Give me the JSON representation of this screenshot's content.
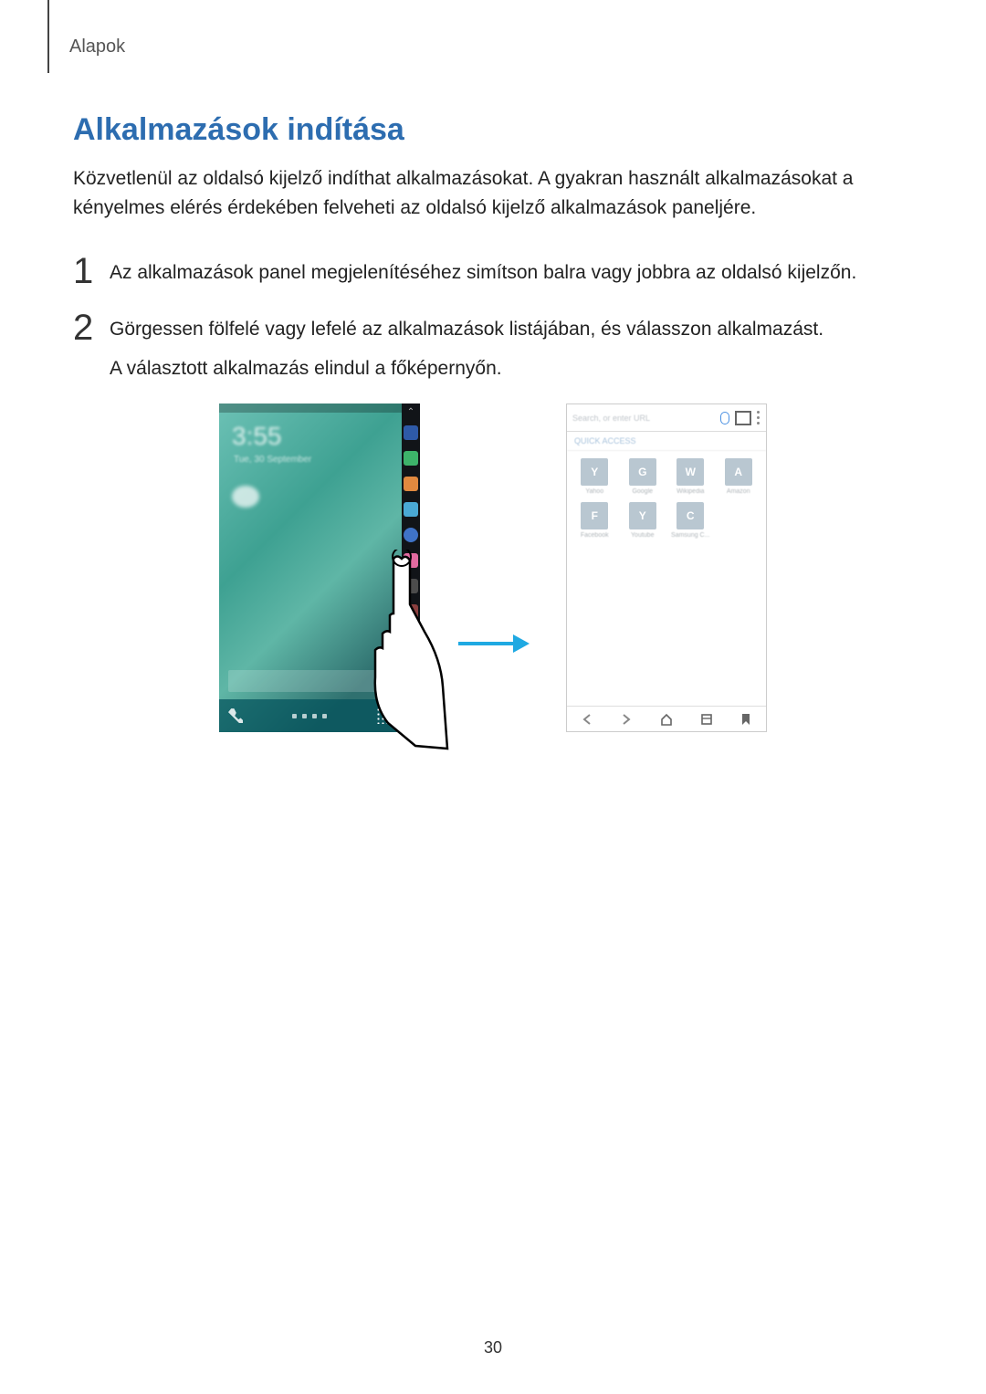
{
  "breadcrumb": "Alapok",
  "heading": "Alkalmazások indítása",
  "intro": "Közvetlenül az oldalsó kijelző indíthat alkalmazásokat. A gyakran használt alkalmazásokat a kényelmes elérés érdekében felveheti az oldalsó kijelző alkalmazások paneljére.",
  "steps": [
    {
      "num": "1",
      "lines": [
        "Az alkalmazások panel megjelenítéséhez simítson balra vagy jobbra az oldalsó kijelzőn."
      ]
    },
    {
      "num": "2",
      "lines": [
        "Görgessen fölfelé vagy lefelé az alkalmazások listájában, és válasszon alkalmazást.",
        "A választott alkalmazás elindul a főképernyőn."
      ]
    }
  ],
  "figure": {
    "left_phone": {
      "clock": "3:55",
      "clock_sub": "Tue, 30 September",
      "edge_icons": [
        "star",
        "phone",
        "contacts",
        "messages",
        "internet",
        "music",
        "play",
        "apps"
      ]
    },
    "right_phone": {
      "url_placeholder": "Search, or enter URL",
      "section_label": "QUICK ACCESS",
      "tiles": [
        {
          "letter": "Y",
          "label": "Yahoo"
        },
        {
          "letter": "G",
          "label": "Google"
        },
        {
          "letter": "W",
          "label": "Wikipedia"
        },
        {
          "letter": "A",
          "label": "Amazon"
        },
        {
          "letter": "F",
          "label": "Facebook"
        },
        {
          "letter": "Y",
          "label": "Youtube"
        },
        {
          "letter": "C",
          "label": "Samsung C..."
        }
      ],
      "bottom_icons": [
        "back",
        "forward",
        "home",
        "tabs",
        "bookmark"
      ]
    }
  },
  "page_number": "30"
}
